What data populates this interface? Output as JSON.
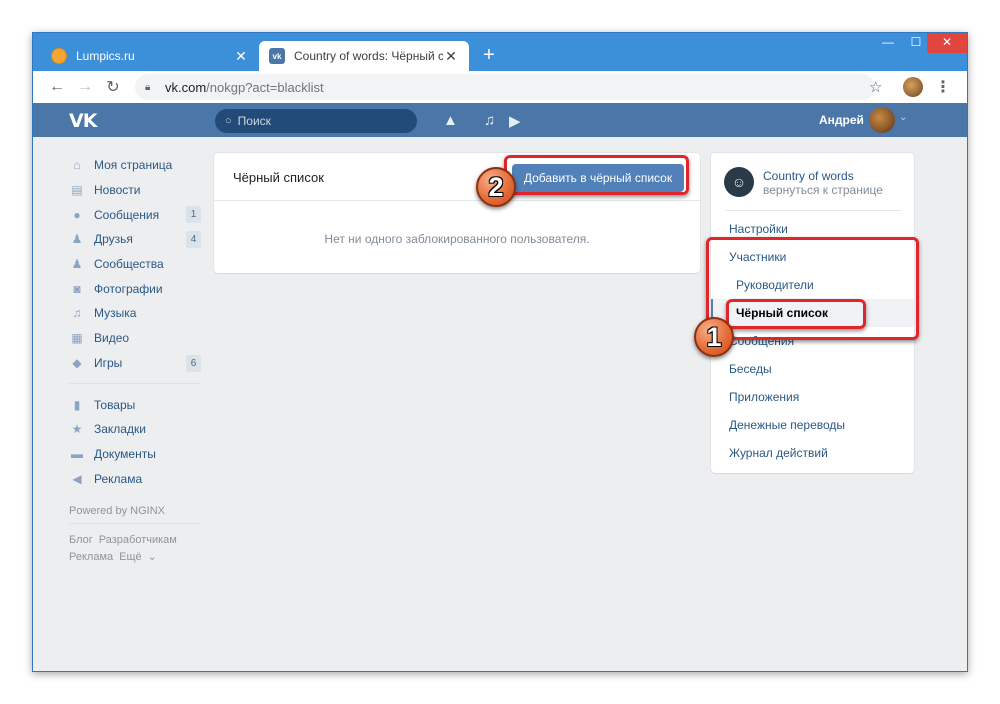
{
  "browser": {
    "tabs": [
      {
        "title": "Lumpics.ru",
        "favicon": "lumpics-favicon",
        "active": false
      },
      {
        "title": "Country of words: Чёрный списс",
        "favicon": "vk-favicon",
        "active": true
      }
    ],
    "new_tab": "+",
    "window_controls": {
      "minimize": "—",
      "maximize": "☐",
      "close": "✕"
    },
    "url_host": "vk.com",
    "url_path": "/nokgp?act=blacklist"
  },
  "header": {
    "logo": "VK",
    "search_placeholder": "Поиск",
    "user_name": "Андрей"
  },
  "leftnav": {
    "items": [
      {
        "label": "Моя страница",
        "icon": "home-icon"
      },
      {
        "label": "Новости",
        "icon": "news-icon"
      },
      {
        "label": "Сообщения",
        "icon": "messages-icon",
        "badge": "1"
      },
      {
        "label": "Друзья",
        "icon": "friends-icon",
        "badge": "4"
      },
      {
        "label": "Сообщества",
        "icon": "communities-icon"
      },
      {
        "label": "Фотографии",
        "icon": "photo-icon"
      },
      {
        "label": "Музыка",
        "icon": "music-icon"
      },
      {
        "label": "Видео",
        "icon": "video-icon"
      },
      {
        "label": "Игры",
        "icon": "games-icon",
        "badge": "6"
      }
    ],
    "items2": [
      {
        "label": "Товары",
        "icon": "goods-icon"
      },
      {
        "label": "Закладки",
        "icon": "bookmarks-icon"
      },
      {
        "label": "Документы",
        "icon": "documents-icon"
      },
      {
        "label": "Реклама",
        "icon": "ads-icon"
      }
    ],
    "powered": "Powered by NGINX",
    "footer": {
      "blog": "Блог",
      "dev": "Разработчикам",
      "ads": "Реклама",
      "more": "Ещё"
    }
  },
  "main": {
    "title": "Чёрный список",
    "add_button": "Добавить в чёрный список",
    "empty_text": "Нет ни одного заблокированного пользователя."
  },
  "rightpanel": {
    "community_name": "Country of words",
    "back_link": "вернуться к странице",
    "items": [
      {
        "label": "Настройки"
      },
      {
        "label": "Участники"
      },
      {
        "label": "Руководители"
      },
      {
        "label": "Чёрный список"
      },
      {
        "label": "Сообщения"
      },
      {
        "label": "Беседы"
      },
      {
        "label": "Приложения"
      },
      {
        "label": "Денежные переводы"
      },
      {
        "label": "Журнал действий"
      }
    ]
  },
  "annotations": {
    "marker1": "1",
    "marker2": "2",
    "highlight_color": "#e0262a"
  }
}
